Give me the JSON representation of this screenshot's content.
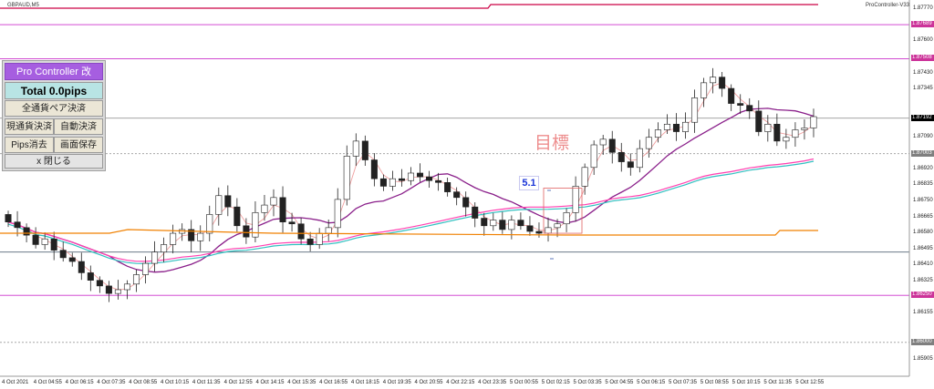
{
  "header": {
    "symbol": "GBPAUD,M5",
    "version": "ProController-V33"
  },
  "panel": {
    "title": "Pro Controller 改",
    "total": "Total   0.0pips",
    "all_pairs_settle": "全通貨ペア決済",
    "current_pair_settle": "現通貨決済",
    "auto_settle": "自動決済",
    "pips_clear": "Pips消去",
    "save_screen": "画面保存",
    "close": "x 閉じる"
  },
  "annotations": {
    "marker_value": "5.1",
    "goal_text": "目標"
  },
  "price_axis": {
    "labels": [
      "1.87770",
      "1.87600",
      "1.87430",
      "1.87345",
      "1.87090",
      "1.86920",
      "1.86835",
      "1.86750",
      "1.86665",
      "1.86580",
      "1.86495",
      "1.86410",
      "1.86325",
      "1.86155",
      "1.85990",
      "1.85905"
    ],
    "tags": [
      {
        "text": "1.87689",
        "color": "#cc3399"
      },
      {
        "text": "1.87508",
        "color": "#cc3399"
      },
      {
        "text": "1.87192",
        "color": "#000000"
      },
      {
        "text": "1.87003",
        "color": "#7f7f7f"
      },
      {
        "text": "1.86250",
        "color": "#cc3399"
      },
      {
        "text": "1.86000",
        "color": "#7f7f7f"
      }
    ]
  },
  "time_axis": {
    "labels": [
      "4 Oct 2021",
      "4 Oct 04:55",
      "4 Oct 06:15",
      "4 Oct 07:35",
      "4 Oct 08:55",
      "4 Oct 10:15",
      "4 Oct 11:35",
      "4 Oct 12:55",
      "4 Oct 14:15",
      "4 Oct 15:35",
      "4 Oct 16:55",
      "4 Oct 18:15",
      "4 Oct 19:35",
      "4 Oct 20:55",
      "4 Oct 22:15",
      "4 Oct 23:35",
      "5 Oct 00:55",
      "5 Oct 02:15",
      "5 Oct 03:35",
      "5 Oct 04:55",
      "5 Oct 06:15",
      "5 Oct 07:35",
      "5 Oct 08:55",
      "5 Oct 10:15",
      "5 Oct 11:35",
      "5 Oct 12:55"
    ]
  },
  "chart_data": {
    "type": "candlestick",
    "ylim": [
      1.8582,
      1.8782
    ],
    "levels": [
      {
        "price": 1.87689,
        "color": "#cc33cc"
      },
      {
        "price": 1.87508,
        "color": "#cc33cc"
      },
      {
        "price": 1.87192,
        "color": "#999999"
      },
      {
        "price": 1.87003,
        "color": "#999999"
      },
      {
        "price": 1.8648,
        "color": "#556677"
      },
      {
        "price": 1.8625,
        "color": "#cc33cc"
      },
      {
        "price": 1.86,
        "color": "#999999"
      }
    ],
    "closes": [
      1.8664,
      1.8661,
      1.8657,
      1.8652,
      1.8655,
      1.8649,
      1.8645,
      1.8643,
      1.8637,
      1.8633,
      1.863,
      1.8626,
      1.8628,
      1.8631,
      1.8636,
      1.8642,
      1.8648,
      1.8652,
      1.8658,
      1.866,
      1.8654,
      1.8658,
      1.8668,
      1.8678,
      1.8672,
      1.8662,
      1.8656,
      1.8669,
      1.8673,
      1.8677,
      1.8664,
      1.8663,
      1.8655,
      1.8652,
      1.8658,
      1.8661,
      1.8676,
      1.8699,
      1.8707,
      1.8697,
      1.8687,
      1.8683,
      1.8687,
      1.8686,
      1.869,
      1.8688,
      1.8686,
      1.8685,
      1.868,
      1.8677,
      1.8672,
      1.8666,
      1.8662,
      1.8665,
      1.866,
      1.8665,
      1.8662,
      1.8659,
      1.8658,
      1.8661,
      1.8663,
      1.8669,
      1.8683,
      1.8693,
      1.8705,
      1.8708,
      1.8701,
      1.8696,
      1.8693,
      1.8703,
      1.8709,
      1.8713,
      1.8716,
      1.8712,
      1.8717,
      1.873,
      1.8738,
      1.8741,
      1.8735,
      1.8727,
      1.8726,
      1.8723,
      1.8712,
      1.8716,
      1.8707,
      1.8709,
      1.8713,
      1.8714,
      1.872
    ],
    "annotation_box": {
      "price_high": 1.8682,
      "price_low": 1.8658
    }
  }
}
